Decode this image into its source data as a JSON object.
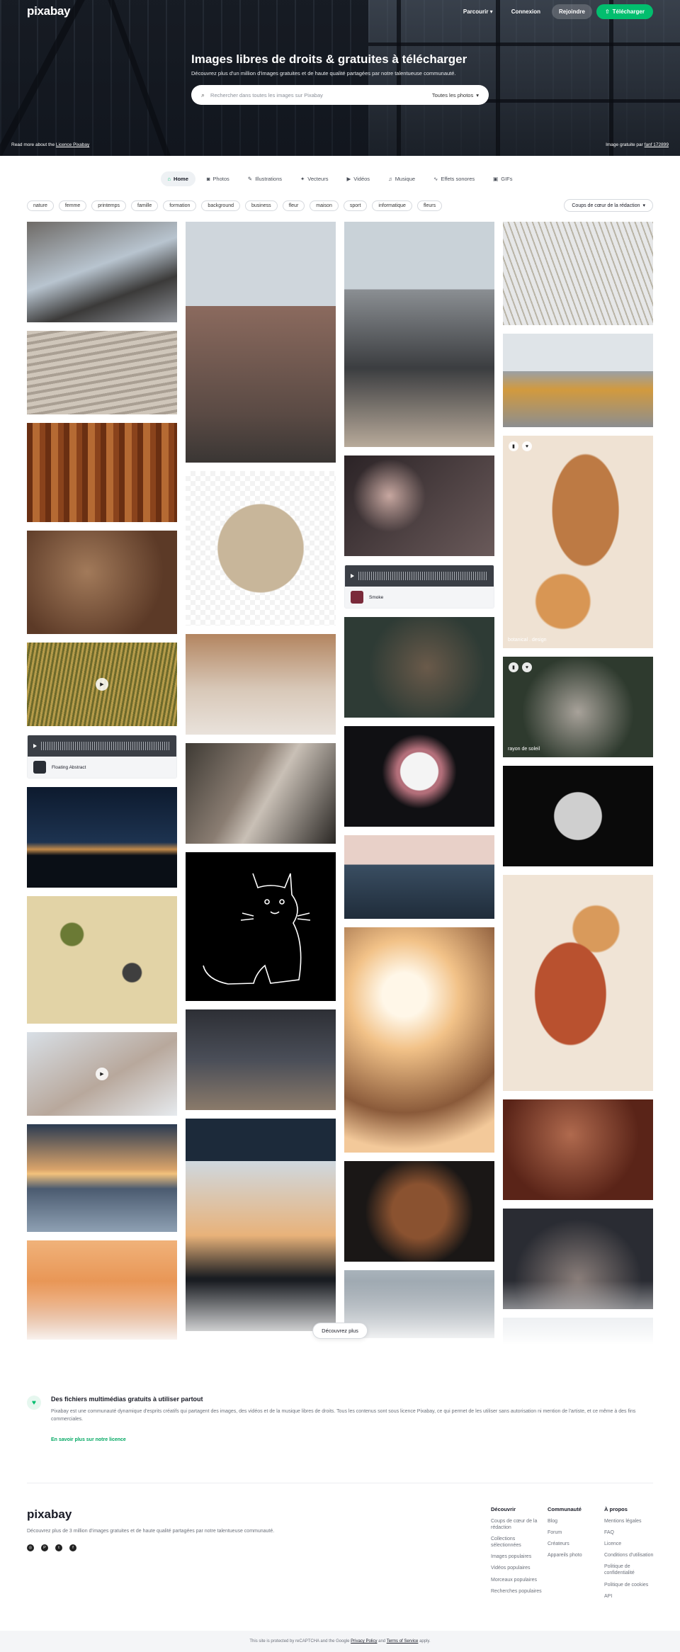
{
  "header": {
    "logo": "pixabay",
    "nav": {
      "explore": "Parcourir",
      "login": "Connexion",
      "join": "Rejoindre",
      "upload": "Télécharger"
    }
  },
  "hero": {
    "title": "Images libres de droits & gratuites à télécharger",
    "subtitle": "Découvrez plus d'un million d'images gratuites et de haute qualité partagées par notre talentueuse communauté.",
    "search_placeholder": "Rechercher dans toutes les images sur Pixabay",
    "search_filter": "Toutes les photos",
    "footnote_left_prefix": "Read more about the",
    "footnote_left_link": "Licence Pixabay",
    "footnote_right_prefix": "Image gratuite par",
    "footnote_right_link": "fanf 172899"
  },
  "tabs": [
    {
      "label": "Home",
      "icon": "home-icon",
      "active": true
    },
    {
      "label": "Photos",
      "icon": "camera-icon"
    },
    {
      "label": "Illustrations",
      "icon": "brush-icon"
    },
    {
      "label": "Vecteurs",
      "icon": "vector-icon"
    },
    {
      "label": "Vidéos",
      "icon": "video-icon"
    },
    {
      "label": "Musique",
      "icon": "music-icon"
    },
    {
      "label": "Effets sonores",
      "icon": "sound-icon"
    },
    {
      "label": "GIFs",
      "icon": "gif-icon"
    }
  ],
  "tags": [
    "nature",
    "femme",
    "printemps",
    "famille",
    "formation",
    "background",
    "business",
    "fleur",
    "maison",
    "sport",
    "informatique",
    "fleurs"
  ],
  "sort": "Coups de cœur de la rédaction",
  "gallery": {
    "col1": [
      {
        "h": 142,
        "bg": "linear-gradient(160deg,#6e6a66,#b8c4cf 45%,#3b3a39 70%,#8d9096)"
      },
      {
        "h": 118,
        "bg": "repeating-linear-gradient(170deg,#cfc6ba 0 6px,#a99f93 6px 10px)"
      },
      {
        "h": 140,
        "bg": "repeating-linear-gradient(90deg,#6a2f12 0 8px,#b56a33 8px 18px,#8a431c 18px 26px)"
      },
      {
        "h": 146,
        "bg": "radial-gradient(circle at 40% 40%,#a27a5a,#5c3a27 70%)"
      },
      {
        "h": 118,
        "bg": "repeating-linear-gradient(100deg,#b59b4a 0 3px,#6e6a2a 3px 6px)",
        "play": true
      },
      {
        "audio": true,
        "title": "Floating Abstract",
        "thumb": "#2a2e35"
      },
      {
        "h": 142,
        "bg": "linear-gradient(180deg,#0d1a2e,#1d3350 55%,#c28a4a 62%,#0a0f16 68%)"
      },
      {
        "h": 180,
        "bg": "radial-gradient(circle at 30% 30%,#6b7a35 8%,transparent 9%),radial-gradient(circle at 70% 60%,#3f3f3f 7%,transparent 8%),#e2d3a6"
      },
      {
        "h": 118,
        "bg": "linear-gradient(150deg,#d8dfe6,#b8a89c 55%,#e6eaee)",
        "play": true
      },
      {
        "h": 152,
        "bg": "linear-gradient(180deg,#2b3b52,#d9a36a 42%,#f2c27c 46%,#4b5b70 60%,#8ea0b3)"
      },
      {
        "h": 140,
        "bg": "linear-gradient(180deg,#f0b27a,#e58a46 60%,#b85f2a)"
      }
    ],
    "col2": [
      {
        "h": 340,
        "bg": "linear-gradient(180deg,#cfd6dc 0 35%,#8b6a5e 35%,#5a4a44 80%,#3a3634)"
      },
      {
        "h": 218,
        "bg": "radial-gradient(ellipse at 50% 50%,#c8b69a 0 40%,transparent 41%),repeating-conic-gradient(#f3f3f3 0 25%,#ffffff 0 50%) 0 0/14px 14px"
      },
      {
        "h": 142,
        "bg": "linear-gradient(180deg,#b38560,#d8c8b8 55%,#e9e2db)"
      },
      {
        "h": 142,
        "bg": "linear-gradient(120deg,#3e3a34,#8a7d72 40%,#c9c0b6 55%,#2a2724)"
      },
      {
        "h": 210,
        "bg": "radial-gradient(ellipse at 55% 55%,transparent 38%,#000 39%),#000",
        "cat": true
      },
      {
        "h": 142,
        "bg": "linear-gradient(180deg,#2d2f35,#4a4e58 50%,#8a7a6a)"
      },
      {
        "h": 300,
        "bg": "linear-gradient(180deg,#1c2a3a 0 20%,#cfd8df 20%,#e8b27a 55%,#1a1d22 75%)"
      }
    ],
    "col3": [
      {
        "h": 318,
        "bg": "linear-gradient(180deg,#c9d2d8 0 30%,#8b8f93 30%,#3b3d40 65%,#b8aa9a)"
      },
      {
        "h": 142,
        "bg": "radial-gradient(circle at 30% 40%,#c7a7a0,transparent 30%),linear-gradient(135deg,#2b2326,#6a5a5a)"
      },
      {
        "audio": true,
        "title": "Smoke",
        "thumb": "#7a2a3a"
      },
      {
        "h": 142,
        "bg": "radial-gradient(circle at 55% 50%,#6a5a4a,#2e3b35 60%)"
      },
      {
        "h": 142,
        "bg": "radial-gradient(circle at 50% 45%,#f4f4f4 0 20%,#b36f7a 21% 24%,#101013 40%)"
      },
      {
        "h": 118,
        "bg": "linear-gradient(180deg,#e8d0c8 0 35%,#3a4e62 35%,#1f2c3a)"
      },
      {
        "h": 318,
        "bg": "radial-gradient(circle at 40% 30%,#fff7e8 0 12%,#f2c288 30%,#8a5a3a 65%,#f3c99a 85%)"
      },
      {
        "h": 142,
        "bg": "radial-gradient(circle at 50% 50%,#8a5230 0 30%,#1a1716 60%)"
      },
      {
        "h": 96,
        "bg": "linear-gradient(180deg,#a9b3bb,#6f7a85)"
      }
    ],
    "col4": [
      {
        "h": 146,
        "bg": "repeating-linear-gradient(70deg,#b9b4a6 0 2px,#e6e7e8 2px 8px)"
      },
      {
        "h": 132,
        "bg": "linear-gradient(180deg,#dfe4e8 0 40%,#9aa0a6 40%,#d29a3e 60%,#8c8e90)"
      },
      {
        "h": 300,
        "bg": "radial-gradient(ellipse at 55% 35%,#bd7a44 0 28%,transparent 29%),radial-gradient(circle at 40% 78%,#d89654 0 14%,transparent 15%),#efe2d3",
        "icons": true,
        "label": "botanical . design"
      },
      {
        "h": 142,
        "bg": "radial-gradient(circle at 50% 55%,#a8a29a,#2e3a2e 60%)",
        "icons": true,
        "label": "rayon de soleil"
      },
      {
        "h": 142,
        "bg": "radial-gradient(circle at 50% 50%,#cfcfcf 0 26%,#0a0a0a 27%)"
      },
      {
        "h": 305,
        "bg": "radial-gradient(ellipse at 45% 55%,#b9512f 0 30%,transparent 31%),radial-gradient(circle at 62% 25%,#d99a5b 0 12%,transparent 13%),#f0e4d6"
      },
      {
        "h": 142,
        "bg": "radial-gradient(circle at 45% 35%,#b06a4e,#5a2418 65%)"
      },
      {
        "h": 142,
        "bg": "radial-gradient(ellipse at 50% 70%,#8a7e7a,#2a2c33 60%)"
      },
      {
        "h": 96,
        "bg": "linear-gradient(180deg,#d7dde2,#b9c2ca)"
      }
    ],
    "more": "Découvrez plus"
  },
  "license": {
    "title": "Des fichiers multimédias gratuits à utiliser partout",
    "text": "Pixabay est une communauté dynamique d'esprits créatifs qui partagent des images, des vidéos et de la musique libres de droits. Tous les contenus sont sous licence Pixabay, ce qui permet de les utiliser sans autorisation ni mention de l'artiste, et ce même à des fins commerciales.",
    "link": "En savoir plus sur notre licence"
  },
  "footer": {
    "logo": "pixabay",
    "description": "Découvrez plus de 3 million d'images gratuites et de haute qualité partagées par notre talentueuse communauté.",
    "col1": {
      "title": "Découvrir",
      "links": [
        "Coups de cœur de la rédaction",
        "Collections sélectionnées",
        "Images populaires",
        "Vidéos populaires",
        "Morceaux populaires",
        "Recherches populaires"
      ]
    },
    "col2": {
      "title": "Communauté",
      "links": [
        "Blog",
        "Forum",
        "Créateurs",
        "Appareils photo"
      ]
    },
    "col3": {
      "title": "À propos",
      "links": [
        "Mentions légales",
        "FAQ",
        "Licence",
        "Conditions d'utilisation",
        "Politique de confidentialité",
        "Politique de cookies",
        "API"
      ]
    },
    "recaptcha_prefix": "This site is protected by reCAPTCHA and the Google",
    "privacy": "Privacy Policy",
    "and": "and",
    "terms": "Terms of Service",
    "suffix": "apply."
  }
}
